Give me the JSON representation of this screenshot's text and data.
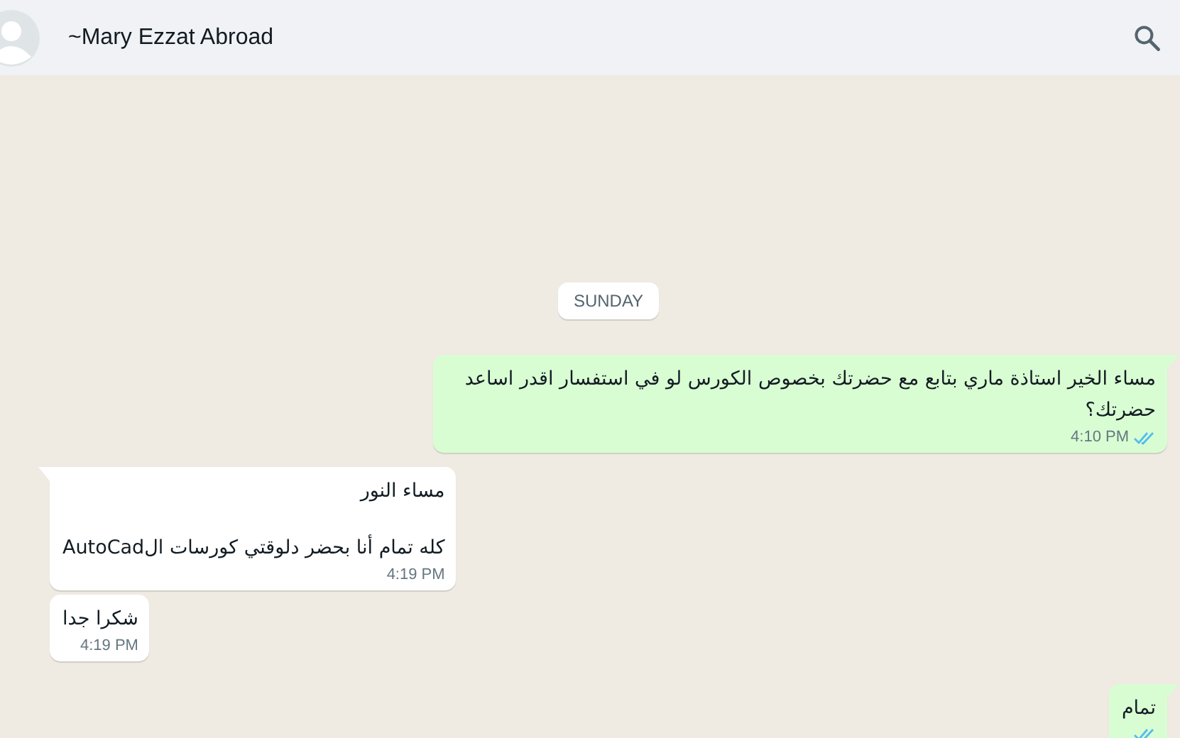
{
  "header": {
    "title": "~Mary Ezzat Abroad"
  },
  "date_chip": "SUNDAY",
  "messages": [
    {
      "kind": "outgoing",
      "tail": true,
      "lines": [
        "مساء الخير استاذة ماري بتابع مع حضرتك بخصوص الكورس لو في استفسار اقدر اساعد حضرتك؟"
      ],
      "time": "4:10 PM",
      "read": true
    },
    {
      "kind": "incoming",
      "tail": true,
      "lines": [
        "مساء النور",
        "كله تمام أنا بحضر دلوقتي كورسات الAutoCad"
      ],
      "time": "4:19 PM"
    },
    {
      "kind": "incoming",
      "tail": false,
      "lines": [
        "شكرا جدا"
      ],
      "time": "4:19 PM"
    },
    {
      "kind": "outgoing",
      "tail": true,
      "lines": [
        "تمام"
      ],
      "read": true
    }
  ]
}
